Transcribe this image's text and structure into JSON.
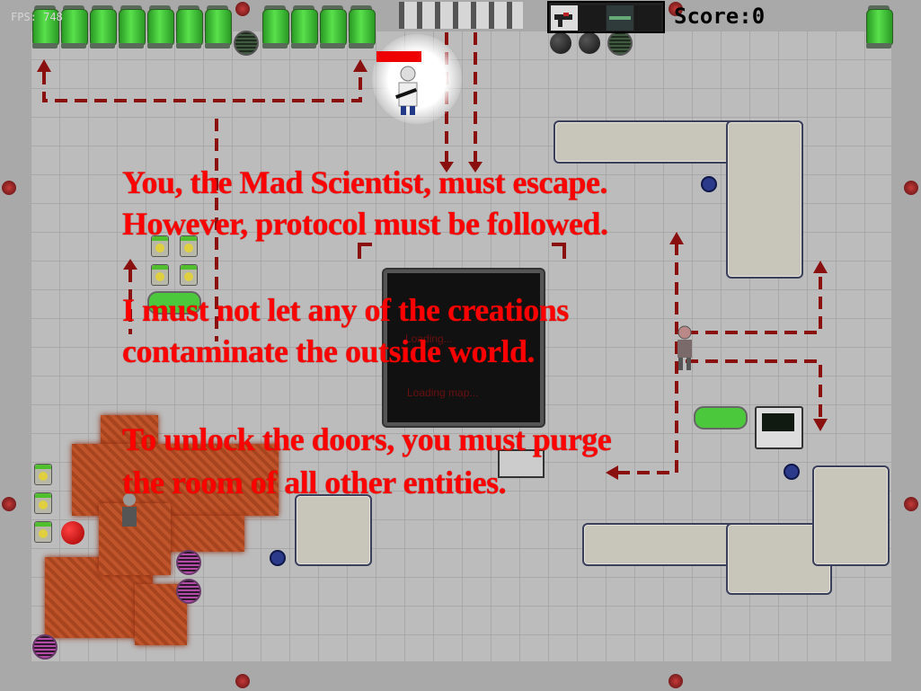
{
  "hud": {
    "fps_label": "FPS: 748",
    "score_label": "Score:",
    "score_value": "0",
    "inventory_slots": [
      "weapon-slot-1",
      "weapon-slot-2",
      "weapon-slot-3",
      "weapon-slot-4"
    ]
  },
  "player": {
    "name": "Mad Scientist",
    "health_fraction": 1.0
  },
  "loading": {
    "title": "Loading...",
    "subtitle": "Loading map..."
  },
  "intro_text": {
    "line1": "You, the Mad Scientist, must escape.",
    "line2": "However, protocol must be followed.",
    "line3": "I must not let any of the creations",
    "line4": "contaminate the outside world.",
    "line5": "To unlock the doors, you must purge",
    "line6": "the room of all other entities."
  },
  "colors": {
    "text_red": "#ff0000",
    "arrow_red": "#8a0f0f",
    "jar_green": "#59e04c",
    "floor": "#bcbcbc"
  }
}
